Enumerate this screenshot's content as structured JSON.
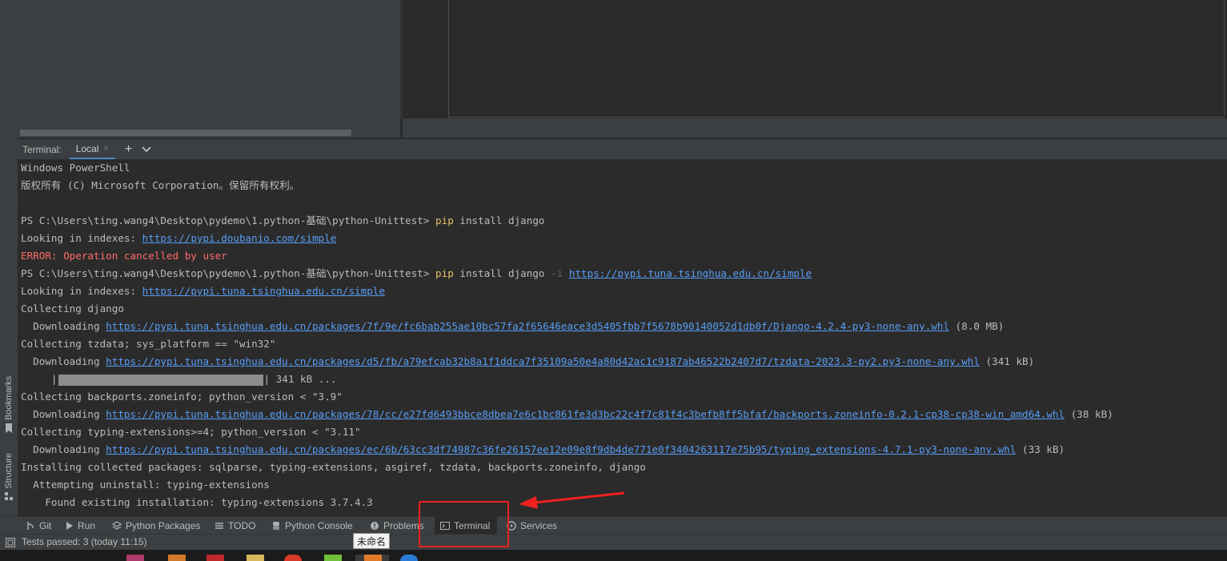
{
  "left_sidebar": {
    "bookmarks_label": "Bookmarks",
    "structure_label": "Structure"
  },
  "terminal": {
    "header_title": "Terminal:",
    "tab_local": "Local",
    "tab_close": "×",
    "new_tab": "+",
    "dropdown": "⌄",
    "lines": {
      "l1": "Windows PowerShell",
      "l2": "版权所有 (C) Microsoft Corporation。保留所有权利。",
      "l3_prompt": "PS C:\\Users\\ting.wang4\\Desktop\\pydemo\\1.python-基础\\python-Unittest> ",
      "l3_cmd": "pip",
      "l3_rest": " install django",
      "l4_text": "Looking in indexes: ",
      "l4_link": "https://pypi.doubanio.com/simple",
      "l5": "ERROR: Operation cancelled by user",
      "l6_prompt": "PS C:\\Users\\ting.wang4\\Desktop\\pydemo\\1.python-基础\\python-Unittest> ",
      "l6_cmd": "pip",
      "l6_rest": " install django ",
      "l6_flag": "-i",
      "l6_space": " ",
      "l6_link": "https://pypi.tuna.tsinghua.edu.cn/simple",
      "l7_text": "Looking in indexes: ",
      "l7_link": "https://pypi.tuna.tsinghua.edu.cn/simple",
      "l8": "Collecting django",
      "l9_text": "  Downloading ",
      "l9_link": "https://pypi.tuna.tsinghua.edu.cn/packages/7f/9e/fc6bab255ae10bc57fa2f65646eace3d5405fbb7f5678b90140052d1db0f/Django-4.2.4-py3-none-any.whl",
      "l9_size": " (8.0 MB)",
      "l10": "Collecting tzdata; sys_platform == \"win32\"",
      "l11_text": "  Downloading ",
      "l11_link": "https://pypi.tuna.tsinghua.edu.cn/packages/d5/fb/a79efcab32b8a1f1ddca7f35109a50e4a80d42ac1c9187ab46522b2407d7/tzdata-2023.3-py2.py3-none-any.whl",
      "l11_size": " (341 kB)",
      "l12_pre": "     |",
      "l12_post": "| 341 kB ...",
      "l13": "Collecting backports.zoneinfo; python_version < \"3.9\"",
      "l14_text": "  Downloading ",
      "l14_link": "https://pypi.tuna.tsinghua.edu.cn/packages/78/cc/e27fd6493bbce8dbea7e6c1bc861fe3d3bc22c4f7c81f4c3befb8ff5bfaf/backports.zoneinfo-0.2.1-cp38-cp38-win_amd64.whl",
      "l14_size": " (38 kB)",
      "l15": "Collecting typing-extensions>=4; python_version < \"3.11\"",
      "l16_text": "  Downloading ",
      "l16_link": "https://pypi.tuna.tsinghua.edu.cn/packages/ec/6b/63cc3df74987c36fe26157ee12e09e8f9db4de771e0f3404263117e75b95/typing_extensions-4.7.1-py3-none-any.whl",
      "l16_size": " (33 kB)",
      "l17": "Installing collected packages: sqlparse, typing-extensions, asgiref, tzdata, backports.zoneinfo, django",
      "l18": "  Attempting uninstall: typing-extensions",
      "l19": "    Found existing installation: typing-extensions 3.7.4.3"
    }
  },
  "tool_tabs": {
    "git": "Git",
    "run": "Run",
    "python_packages": "Python Packages",
    "todo": "TODO",
    "python_console": "Python Console",
    "problems": "Problems",
    "terminal": "Terminal",
    "services": "Services"
  },
  "status": {
    "text": "Tests passed: 3 (today 11:15)"
  },
  "tooltip": {
    "text": "未命名"
  },
  "colors": {
    "annotation_red": "#ee2020",
    "link": "#589df6",
    "command": "#e8bf6a",
    "error": "#ff6b68"
  }
}
